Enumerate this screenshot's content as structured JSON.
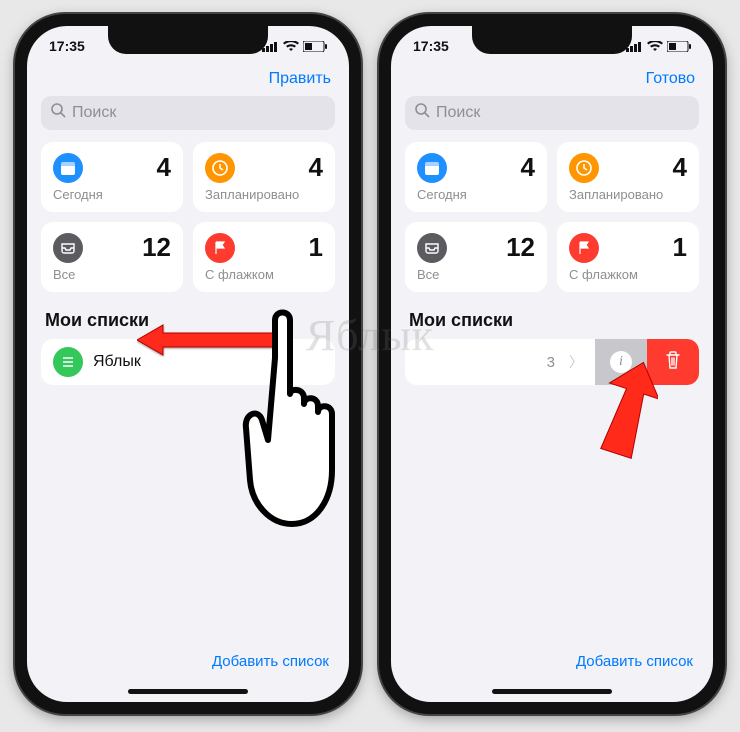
{
  "statusbar": {
    "time": "17:35"
  },
  "left": {
    "nav_button": "Править",
    "search_placeholder": "Поиск",
    "cards": [
      {
        "label": "Сегодня",
        "count": "4",
        "icon": "calendar-icon",
        "color": "blue"
      },
      {
        "label": "Запланировано",
        "count": "4",
        "icon": "clock-icon",
        "color": "orange"
      },
      {
        "label": "Все",
        "count": "12",
        "icon": "inbox-icon",
        "color": "gray"
      },
      {
        "label": "С флажком",
        "count": "1",
        "icon": "flag-icon",
        "color": "red"
      }
    ],
    "section_title": "Мои списки",
    "list_item": {
      "name": "Яблык"
    },
    "footer": "Добавить список"
  },
  "right": {
    "nav_button": "Готово",
    "search_placeholder": "Поиск",
    "cards": [
      {
        "label": "Сегодня",
        "count": "4",
        "icon": "calendar-icon",
        "color": "blue"
      },
      {
        "label": "Запланировано",
        "count": "4",
        "icon": "clock-icon",
        "color": "orange"
      },
      {
        "label": "Все",
        "count": "12",
        "icon": "inbox-icon",
        "color": "gray"
      },
      {
        "label": "С флажком",
        "count": "1",
        "icon": "flag-icon",
        "color": "red"
      }
    ],
    "section_title": "Мои списки",
    "swipe_item": {
      "count": "3"
    },
    "footer": "Добавить список"
  },
  "watermark": "Яблык"
}
